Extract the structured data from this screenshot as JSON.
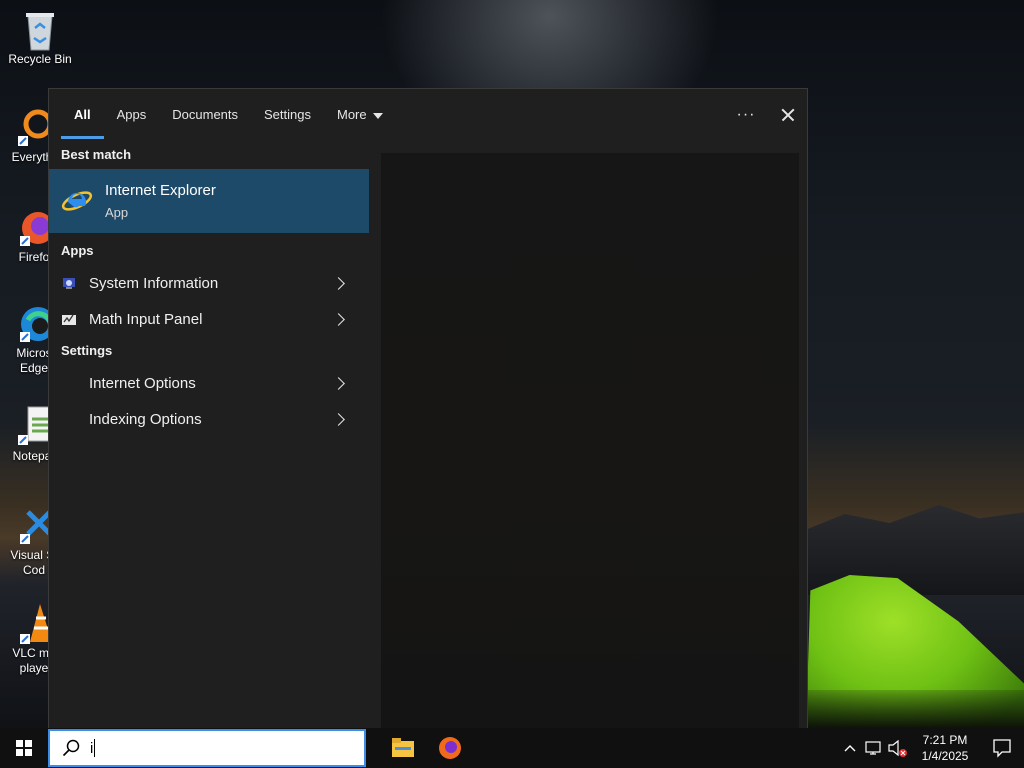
{
  "desktop": {
    "icons": [
      {
        "name": "recycle-bin-icon",
        "label": "Recycle Bin"
      },
      {
        "name": "everything-icon",
        "label": "Everyth"
      },
      {
        "name": "firefox-icon",
        "label": "Firefo"
      },
      {
        "name": "edge-icon",
        "label": "Micros\nEdge"
      },
      {
        "name": "notepad-icon",
        "label": "Notepa"
      },
      {
        "name": "vscode-icon",
        "label": "Visual St\nCod"
      },
      {
        "name": "vlc-icon",
        "label": "VLC me\nplaye"
      }
    ]
  },
  "search_panel": {
    "tabs": [
      "All",
      "Apps",
      "Documents",
      "Settings",
      "More"
    ],
    "active_tab": "All",
    "more_icon": "chevron-down-icon",
    "options_icon": "ellipsis-icon",
    "close_icon": "close-icon",
    "best_match_heading": "Best match",
    "best_match": {
      "name": "Internet Explorer",
      "type": "App",
      "icon": "internet-explorer-icon"
    },
    "apps_heading": "Apps",
    "apps": [
      {
        "label": "System Information",
        "icon": "system-information-icon"
      },
      {
        "label": "Math Input Panel",
        "icon": "math-input-panel-icon"
      }
    ],
    "settings_heading": "Settings",
    "settings": [
      {
        "label": "Internet Options"
      },
      {
        "label": "Indexing Options"
      }
    ]
  },
  "taskbar": {
    "start_icon": "windows-logo-icon",
    "search": {
      "icon": "search-icon",
      "value": "i"
    },
    "pinned": [
      {
        "name": "file-explorer-icon"
      },
      {
        "name": "firefox-icon"
      }
    ],
    "tray": {
      "chevron": "chevron-up-icon",
      "network": "network-icon",
      "volume": "volume-muted-icon",
      "time": "7:21 PM",
      "date": "1/4/2025",
      "notifications": "notification-icon"
    }
  },
  "colors": {
    "accent": "#4c9ce8",
    "selection": "#1e4a6a",
    "panel_bg": "#1f1f1f",
    "taskbar_bg": "#101010"
  }
}
